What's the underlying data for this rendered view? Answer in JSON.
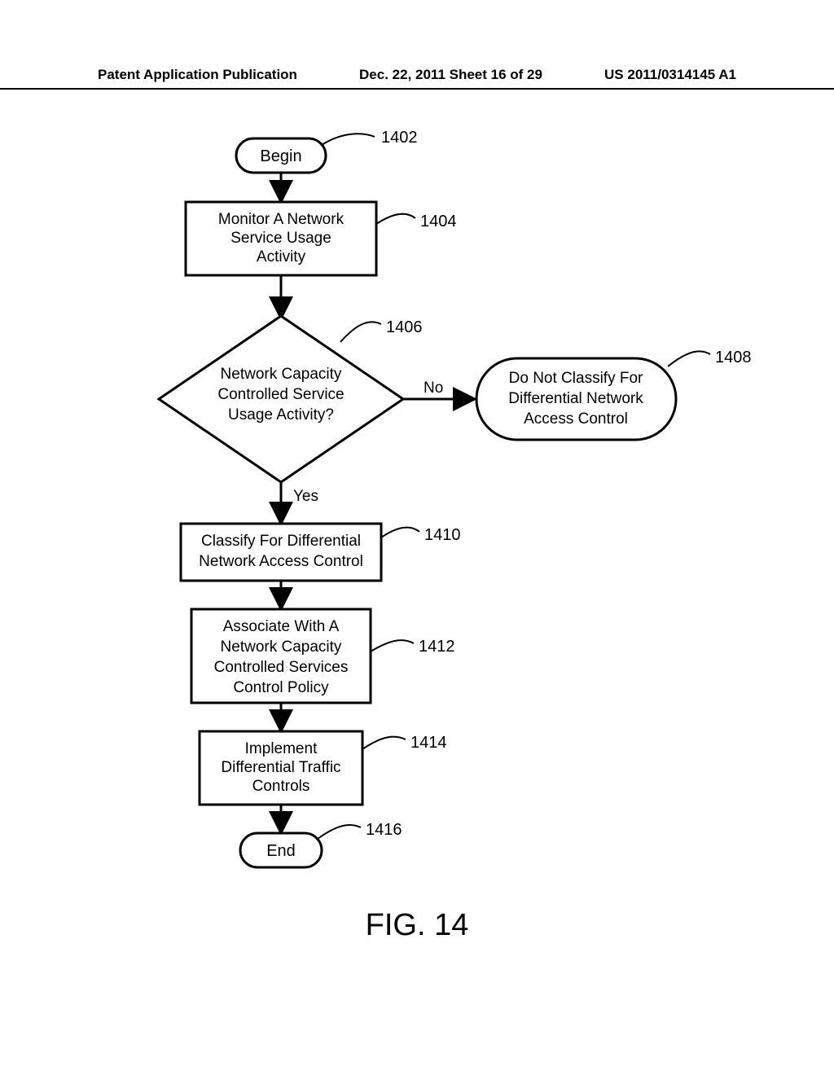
{
  "header": {
    "left": "Patent Application Publication",
    "center": "Dec. 22, 2011  Sheet 16 of 29",
    "right": "US 2011/0314145 A1"
  },
  "figure_caption": "FIG. 14",
  "chart_data": {
    "type": "flowchart",
    "nodes": [
      {
        "id": "1402",
        "shape": "terminator",
        "label": "Begin",
        "ref": "1402"
      },
      {
        "id": "1404",
        "shape": "process",
        "label": "Monitor A Network Service Usage Activity",
        "ref": "1404"
      },
      {
        "id": "1406",
        "shape": "decision",
        "label": "Network Capacity Controlled Service Usage Activity?",
        "ref": "1406"
      },
      {
        "id": "1408",
        "shape": "terminator",
        "label": "Do Not Classify For Differential Network Access Control",
        "ref": "1408"
      },
      {
        "id": "1410",
        "shape": "process",
        "label": "Classify For Differential Network Access Control",
        "ref": "1410"
      },
      {
        "id": "1412",
        "shape": "process",
        "label": "Associate With A Network Capacity Controlled Services Control Policy",
        "ref": "1412"
      },
      {
        "id": "1414",
        "shape": "process",
        "label": "Implement Differential Traffic Controls",
        "ref": "1414"
      },
      {
        "id": "1416",
        "shape": "terminator",
        "label": "End",
        "ref": "1416"
      }
    ],
    "edges": [
      {
        "from": "1402",
        "to": "1404"
      },
      {
        "from": "1404",
        "to": "1406"
      },
      {
        "from": "1406",
        "to": "1408",
        "label": "No"
      },
      {
        "from": "1406",
        "to": "1410",
        "label": "Yes"
      },
      {
        "from": "1410",
        "to": "1412"
      },
      {
        "from": "1412",
        "to": "1414"
      },
      {
        "from": "1414",
        "to": "1416"
      }
    ]
  }
}
